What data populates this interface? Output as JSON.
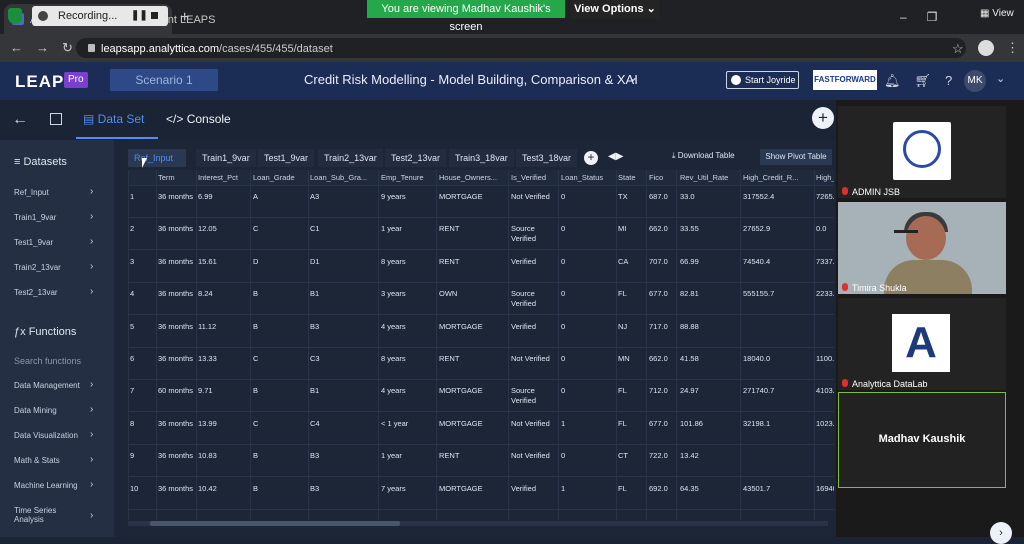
{
  "zoom": {
    "recording_label": "Recording...",
    "viewing_banner": "You are viewing Madhav Kaushik's screen",
    "view_options": "View Options",
    "view_button": "View",
    "participants": [
      {
        "name": "ADMIN JSB"
      },
      {
        "name": "Timira Shukla"
      },
      {
        "name": "Analyttica DataLab"
      },
      {
        "name": "Madhav Kaushik"
      }
    ]
  },
  "browser": {
    "tab_title": "ATH | Analyttica TreasureHunt LEAPS",
    "url_host": "leapsapp.analyttica.com",
    "url_path": "/cases/455/455/dataset"
  },
  "app": {
    "logo": "LEAPS",
    "logo_badge": "Pro",
    "scenario": "Scenario 1",
    "title": "Credit Risk Modelling - Model Building, Comparison & XAI",
    "joyride": "Start Joyride",
    "brand": "FASTFORWARD",
    "avatar": "MK",
    "tabs": {
      "dataset": "Data Set",
      "console": "Console"
    }
  },
  "sidebar": {
    "datasets_heading": "Datasets",
    "datasets": [
      "Ref_Input",
      "Train1_9var",
      "Test1_9var",
      "Train2_13var",
      "Test2_13var"
    ],
    "functions_heading": "Functions",
    "search_placeholder": "Search functions",
    "functions": [
      "Data Management",
      "Data Mining",
      "Data Visualization",
      "Math & Stats",
      "Machine Learning",
      "Time Series Analysis"
    ]
  },
  "dataset_tabs": [
    "Ref_Input",
    "Train1_9var",
    "Test1_9var",
    "Train2_13var",
    "Test2_13var",
    "Train3_18var",
    "Test3_18var"
  ],
  "table_actions": {
    "download": "Download Table",
    "pivot": "Show Pivot Table"
  },
  "table": {
    "columns": [
      "",
      "Term",
      "Interest_Pct",
      "Loan_Grade",
      "Loan_Sub_Gra...",
      "Emp_Tenure",
      "House_Owners...",
      "Is_Verified",
      "Loan_Status",
      "State",
      "Fico",
      "Rev_Util_Rate",
      "High_Credit_R...",
      "High_..."
    ],
    "rows": [
      [
        "1",
        "36 months",
        "6.99",
        "A",
        "A3",
        "9 years",
        "MORTGAGE",
        "Not Verified",
        "0",
        "TX",
        "687.0",
        "33.0",
        "317552.4",
        "7265..."
      ],
      [
        "2",
        "36 months",
        "12.05",
        "C",
        "C1",
        "1 year",
        "RENT",
        "Source Verified",
        "0",
        "MI",
        "662.0",
        "33.55",
        "27652.9",
        "0.0"
      ],
      [
        "3",
        "36 months",
        "15.61",
        "D",
        "D1",
        "8 years",
        "RENT",
        "Verified",
        "0",
        "CA",
        "707.0",
        "66.99",
        "74540.4",
        "7337..."
      ],
      [
        "4",
        "36 months",
        "8.24",
        "B",
        "B1",
        "3 years",
        "OWN",
        "Source Verified",
        "0",
        "FL",
        "677.0",
        "82.81",
        "555155.7",
        "2233..."
      ],
      [
        "5",
        "36 months",
        "11.12",
        "B",
        "B3",
        "4 years",
        "MORTGAGE",
        "Verified",
        "0",
        "NJ",
        "717.0",
        "88.88",
        "",
        ""
      ],
      [
        "6",
        "36 months",
        "13.33",
        "C",
        "C3",
        "8 years",
        "RENT",
        "Not Verified",
        "0",
        "MN",
        "662.0",
        "41.58",
        "18040.0",
        "1100..."
      ],
      [
        "7",
        "60 months",
        "9.71",
        "B",
        "B1",
        "4 years",
        "MORTGAGE",
        "Source Verified",
        "0",
        "FL",
        "712.0",
        "24.97",
        "271740.7",
        "4103..."
      ],
      [
        "8",
        "36 months",
        "13.99",
        "C",
        "C4",
        "< 1 year",
        "MORTGAGE",
        "Not Verified",
        "1",
        "FL",
        "677.0",
        "101.86",
        "32198.1",
        "1023..."
      ],
      [
        "9",
        "36 months",
        "10.83",
        "B",
        "B3",
        "1 year",
        "RENT",
        "Not Verified",
        "0",
        "CT",
        "722.0",
        "13.42",
        "",
        ""
      ],
      [
        "10",
        "36 months",
        "10.42",
        "B",
        "B3",
        "7 years",
        "MORTGAGE",
        "Verified",
        "1",
        "FL",
        "692.0",
        "64.35",
        "43501.7",
        "16940..."
      ]
    ]
  }
}
